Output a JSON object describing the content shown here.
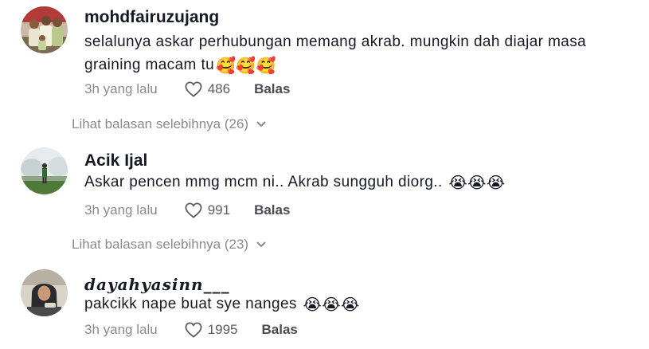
{
  "comments": [
    {
      "username": "mohdfairuzujang",
      "text": "selalunya askar perhubungan memang akrab. mungkin dah diajar masa graining macam tu",
      "emojis": "🥰🥰🥰",
      "time": "3h yang lalu",
      "likes": "486",
      "reply_label": "Balas",
      "avatar_icon": "family-photo-avatar",
      "view_replies": "Lihat balasan selebihnya (26)"
    },
    {
      "username": "Acik Ijal",
      "text": "Askar pencen mmg mcm ni.. Akrab sungguh diorg..",
      "emojis": "😭😭😭",
      "time": "3h yang lalu",
      "likes": "991",
      "reply_label": "Balas",
      "avatar_icon": "outdoor-person-avatar",
      "view_replies": "Lihat balasan selebihnya (23)"
    },
    {
      "username": "𝒅𝒂𝒚𝒂𝒉𝒚𝒂𝒔𝒊𝒏𝒏___",
      "text": "pakcikk nape buat sye nanges",
      "emojis": "😭😭😭",
      "time": "3h yang lalu",
      "likes": "1995",
      "reply_label": "Balas",
      "avatar_icon": "woman-hijab-avatar"
    }
  ],
  "colors": {
    "text": "#161823",
    "secondary": "#8a8b91",
    "emoji_face": "#ffcc4d"
  }
}
